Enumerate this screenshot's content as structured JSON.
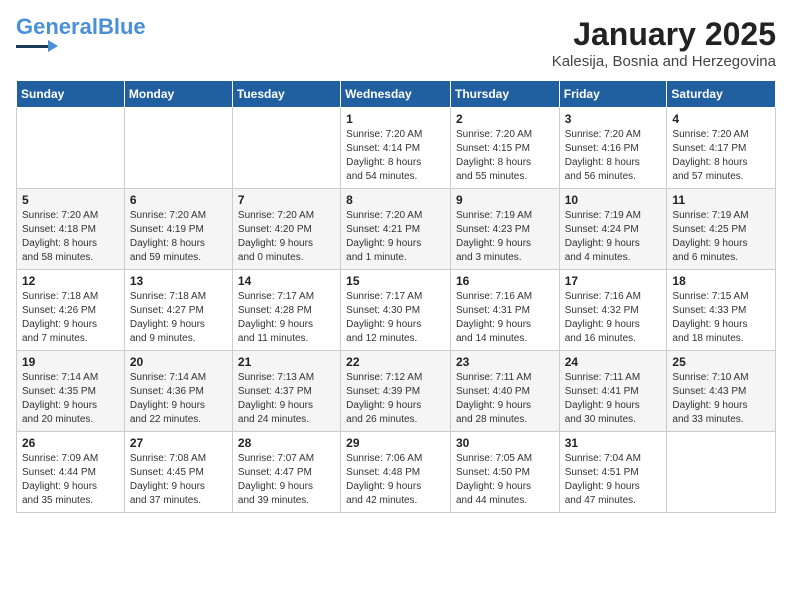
{
  "header": {
    "logo_line1": "General",
    "logo_line2": "Blue",
    "title": "January 2025",
    "location": "Kalesija, Bosnia and Herzegovina"
  },
  "days_of_week": [
    "Sunday",
    "Monday",
    "Tuesday",
    "Wednesday",
    "Thursday",
    "Friday",
    "Saturday"
  ],
  "weeks": [
    [
      {
        "day": "",
        "info": ""
      },
      {
        "day": "",
        "info": ""
      },
      {
        "day": "",
        "info": ""
      },
      {
        "day": "1",
        "info": "Sunrise: 7:20 AM\nSunset: 4:14 PM\nDaylight: 8 hours\nand 54 minutes."
      },
      {
        "day": "2",
        "info": "Sunrise: 7:20 AM\nSunset: 4:15 PM\nDaylight: 8 hours\nand 55 minutes."
      },
      {
        "day": "3",
        "info": "Sunrise: 7:20 AM\nSunset: 4:16 PM\nDaylight: 8 hours\nand 56 minutes."
      },
      {
        "day": "4",
        "info": "Sunrise: 7:20 AM\nSunset: 4:17 PM\nDaylight: 8 hours\nand 57 minutes."
      }
    ],
    [
      {
        "day": "5",
        "info": "Sunrise: 7:20 AM\nSunset: 4:18 PM\nDaylight: 8 hours\nand 58 minutes."
      },
      {
        "day": "6",
        "info": "Sunrise: 7:20 AM\nSunset: 4:19 PM\nDaylight: 8 hours\nand 59 minutes."
      },
      {
        "day": "7",
        "info": "Sunrise: 7:20 AM\nSunset: 4:20 PM\nDaylight: 9 hours\nand 0 minutes."
      },
      {
        "day": "8",
        "info": "Sunrise: 7:20 AM\nSunset: 4:21 PM\nDaylight: 9 hours\nand 1 minute."
      },
      {
        "day": "9",
        "info": "Sunrise: 7:19 AM\nSunset: 4:23 PM\nDaylight: 9 hours\nand 3 minutes."
      },
      {
        "day": "10",
        "info": "Sunrise: 7:19 AM\nSunset: 4:24 PM\nDaylight: 9 hours\nand 4 minutes."
      },
      {
        "day": "11",
        "info": "Sunrise: 7:19 AM\nSunset: 4:25 PM\nDaylight: 9 hours\nand 6 minutes."
      }
    ],
    [
      {
        "day": "12",
        "info": "Sunrise: 7:18 AM\nSunset: 4:26 PM\nDaylight: 9 hours\nand 7 minutes."
      },
      {
        "day": "13",
        "info": "Sunrise: 7:18 AM\nSunset: 4:27 PM\nDaylight: 9 hours\nand 9 minutes."
      },
      {
        "day": "14",
        "info": "Sunrise: 7:17 AM\nSunset: 4:28 PM\nDaylight: 9 hours\nand 11 minutes."
      },
      {
        "day": "15",
        "info": "Sunrise: 7:17 AM\nSunset: 4:30 PM\nDaylight: 9 hours\nand 12 minutes."
      },
      {
        "day": "16",
        "info": "Sunrise: 7:16 AM\nSunset: 4:31 PM\nDaylight: 9 hours\nand 14 minutes."
      },
      {
        "day": "17",
        "info": "Sunrise: 7:16 AM\nSunset: 4:32 PM\nDaylight: 9 hours\nand 16 minutes."
      },
      {
        "day": "18",
        "info": "Sunrise: 7:15 AM\nSunset: 4:33 PM\nDaylight: 9 hours\nand 18 minutes."
      }
    ],
    [
      {
        "day": "19",
        "info": "Sunrise: 7:14 AM\nSunset: 4:35 PM\nDaylight: 9 hours\nand 20 minutes."
      },
      {
        "day": "20",
        "info": "Sunrise: 7:14 AM\nSunset: 4:36 PM\nDaylight: 9 hours\nand 22 minutes."
      },
      {
        "day": "21",
        "info": "Sunrise: 7:13 AM\nSunset: 4:37 PM\nDaylight: 9 hours\nand 24 minutes."
      },
      {
        "day": "22",
        "info": "Sunrise: 7:12 AM\nSunset: 4:39 PM\nDaylight: 9 hours\nand 26 minutes."
      },
      {
        "day": "23",
        "info": "Sunrise: 7:11 AM\nSunset: 4:40 PM\nDaylight: 9 hours\nand 28 minutes."
      },
      {
        "day": "24",
        "info": "Sunrise: 7:11 AM\nSunset: 4:41 PM\nDaylight: 9 hours\nand 30 minutes."
      },
      {
        "day": "25",
        "info": "Sunrise: 7:10 AM\nSunset: 4:43 PM\nDaylight: 9 hours\nand 33 minutes."
      }
    ],
    [
      {
        "day": "26",
        "info": "Sunrise: 7:09 AM\nSunset: 4:44 PM\nDaylight: 9 hours\nand 35 minutes."
      },
      {
        "day": "27",
        "info": "Sunrise: 7:08 AM\nSunset: 4:45 PM\nDaylight: 9 hours\nand 37 minutes."
      },
      {
        "day": "28",
        "info": "Sunrise: 7:07 AM\nSunset: 4:47 PM\nDaylight: 9 hours\nand 39 minutes."
      },
      {
        "day": "29",
        "info": "Sunrise: 7:06 AM\nSunset: 4:48 PM\nDaylight: 9 hours\nand 42 minutes."
      },
      {
        "day": "30",
        "info": "Sunrise: 7:05 AM\nSunset: 4:50 PM\nDaylight: 9 hours\nand 44 minutes."
      },
      {
        "day": "31",
        "info": "Sunrise: 7:04 AM\nSunset: 4:51 PM\nDaylight: 9 hours\nand 47 minutes."
      },
      {
        "day": "",
        "info": ""
      }
    ]
  ]
}
